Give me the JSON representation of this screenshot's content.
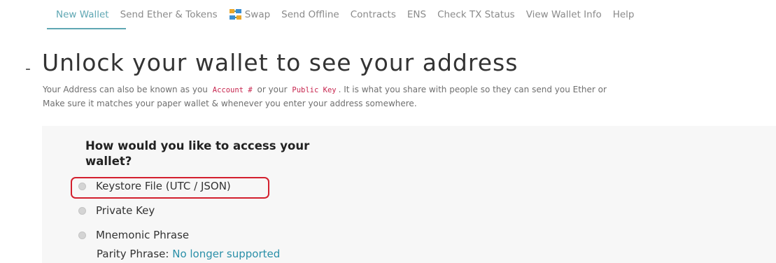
{
  "nav": {
    "items": [
      {
        "label": "New Wallet",
        "active": true
      },
      {
        "label": "Send Ether & Tokens"
      },
      {
        "label": "Swap",
        "icon": "swap-icon"
      },
      {
        "label": "Send Offline"
      },
      {
        "label": "Contracts"
      },
      {
        "label": "ENS"
      },
      {
        "label": "Check TX Status"
      },
      {
        "label": "View Wallet Info"
      },
      {
        "label": "Help"
      }
    ]
  },
  "header": {
    "toggle": "-",
    "title": "Unlock your wallet to see your address"
  },
  "description": {
    "line1_prefix": "Your Address can also be known as you",
    "account_code": "Account #",
    "line1_mid": "or your",
    "public_key_code": "Public Key",
    "line1_suffix": ". It is what you share with people so they can send you Ether or",
    "line2": "Make sure it matches your paper wallet & whenever you enter your address somewhere."
  },
  "access": {
    "question": "How would you like to access your wallet?",
    "options": [
      {
        "label": "Keystore File (UTC / JSON)",
        "highlighted": true
      },
      {
        "label": "Private Key"
      },
      {
        "label": "Mnemonic Phrase"
      }
    ],
    "parity_label": "Parity Phrase:",
    "parity_link": "No longer supported"
  },
  "colors": {
    "accent": "#5fa7b3",
    "link": "#2a8fa8",
    "code": "#c7254e",
    "highlight_border": "#d3202e",
    "panel_bg": "#f7f7f7"
  }
}
